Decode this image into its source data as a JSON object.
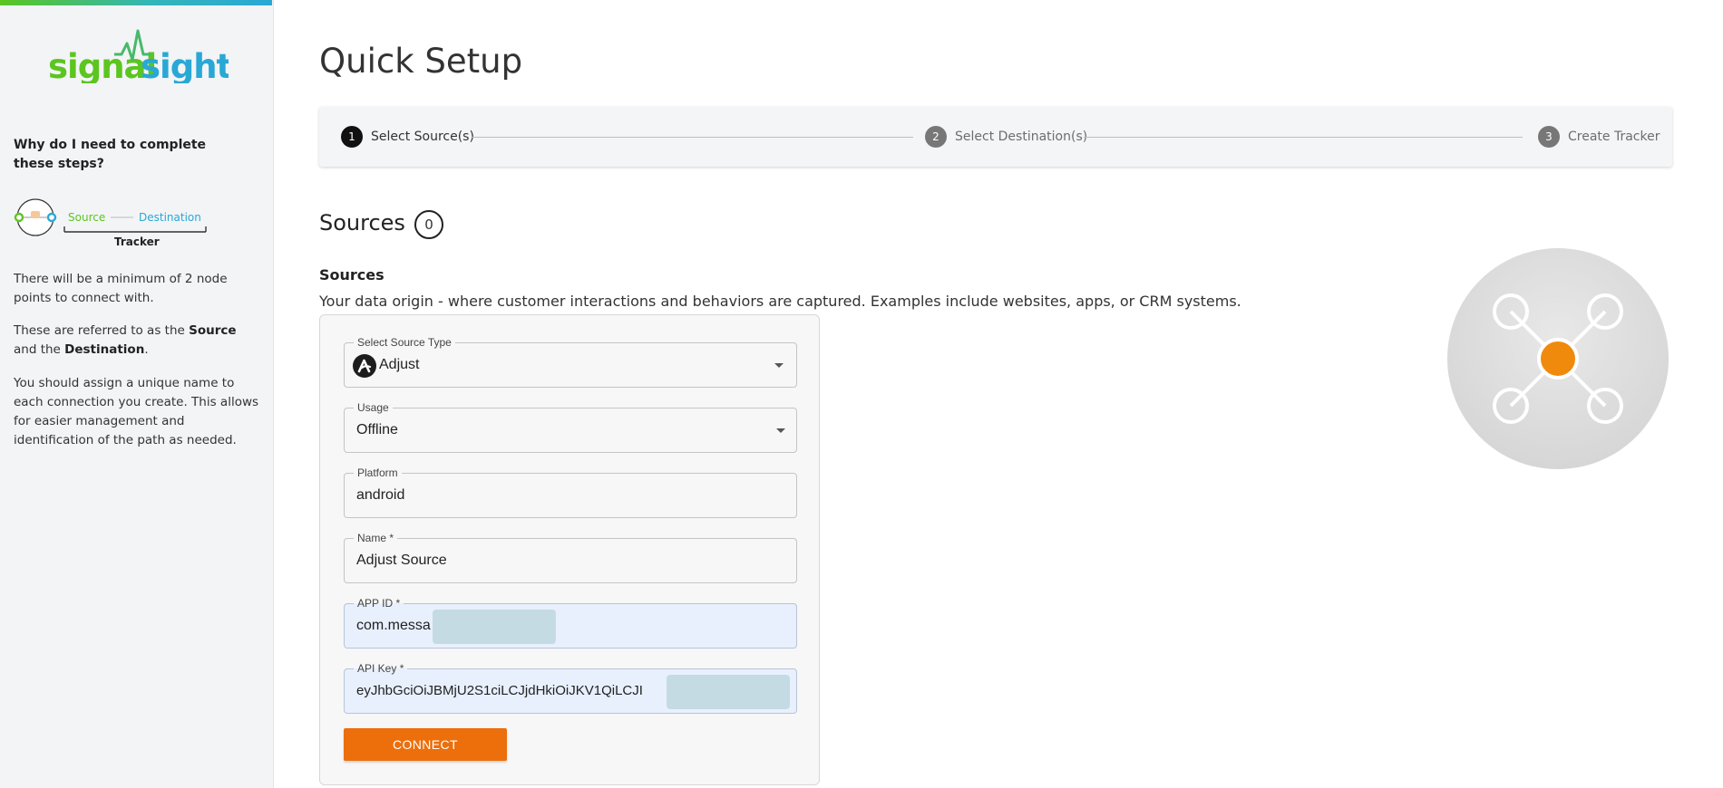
{
  "app": {
    "logo_text": "signalsight",
    "brand_green": "#5cc51f",
    "brand_blue": "#29a8d6",
    "accent_orange": "#ec6f0c"
  },
  "sidebar": {
    "heading": "Why do I need to complete these steps?",
    "diagram": {
      "source_label": "Source",
      "destination_label": "Destination",
      "tracker_label": "Tracker"
    },
    "paragraph_1": "There will be a minimum of 2 node points to connect with.",
    "paragraph_2_before": "These are referred to as the ",
    "paragraph_2_source": "Source",
    "paragraph_2_and": " and the ",
    "paragraph_2_destination": "Destination",
    "paragraph_2_after": ".",
    "paragraph_3": "You should assign a unique name to each connection you create. This allows for easier management and identification of the path as needed."
  },
  "header": {
    "title": "Quick Setup"
  },
  "stepper": {
    "steps": [
      {
        "number": "1",
        "label": "Select Source(s)",
        "active": true
      },
      {
        "number": "2",
        "label": "Select Destination(s)",
        "active": false
      },
      {
        "number": "3",
        "label": "Create Tracker",
        "active": false
      }
    ]
  },
  "sources": {
    "title": "Sources",
    "count": "0",
    "subheading": "Sources",
    "description": "Your data origin - where customer interactions and behaviors are captured. Examples include websites, apps, or CRM systems."
  },
  "form": {
    "source_type": {
      "label": "Select Source Type",
      "value": "Adjust",
      "icon": "adjust-logo-icon"
    },
    "usage": {
      "label": "Usage",
      "value": "Offline"
    },
    "platform": {
      "label": "Platform",
      "value": "android"
    },
    "name": {
      "label": "Name *",
      "value": "Adjust Source"
    },
    "app_id": {
      "label": "APP ID *",
      "value": "com.messa"
    },
    "api_key": {
      "label": "API Key *",
      "value": "eyJhbGciOiJBMjU2S1ciLCJjdHkiOiJKV1QiLCJI"
    },
    "connect_label": "CONNECT"
  }
}
